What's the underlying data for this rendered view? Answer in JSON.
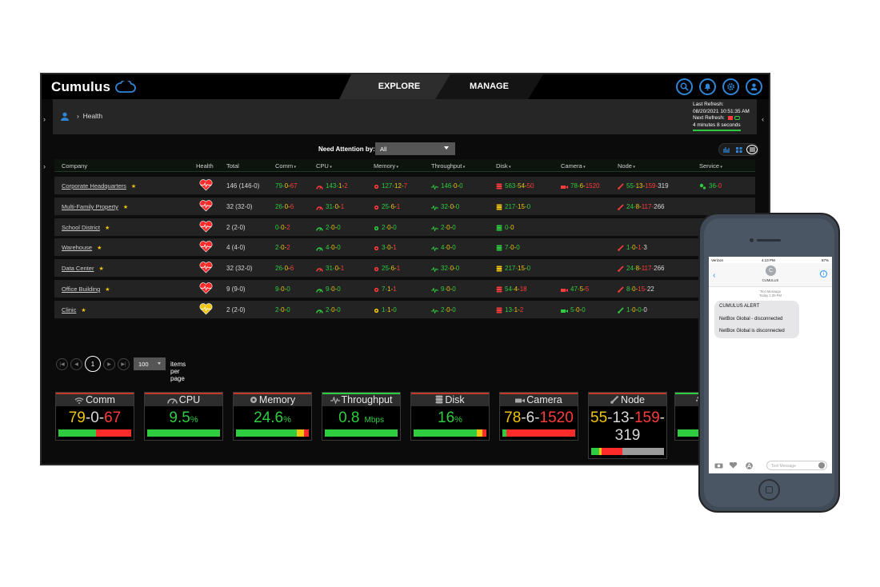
{
  "app": {
    "title": "Cumulus"
  },
  "nav": {
    "tabs": [
      "EXPLORE",
      "MANAGE"
    ]
  },
  "breadcrumb": {
    "current": "Health"
  },
  "refresh": {
    "last_label": "Last Refresh:",
    "last_value": "08/20/2021 10:51:35 AM",
    "next_label": "Next Refresh:",
    "countdown": "4 minutes 8 seconds"
  },
  "filter": {
    "label": "Need Attention by:",
    "value": "All"
  },
  "table": {
    "headers": [
      "Company",
      "Health",
      "Total",
      "Comm",
      "CPU",
      "Memory",
      "Throughput",
      "Disk",
      "Camera",
      "Node",
      "Service"
    ],
    "rows": [
      {
        "company": "Corporate Headquarters",
        "health": "red",
        "total": "146 (146-0)",
        "comm": [
          "79",
          "0",
          "67"
        ],
        "cpu": [
          "143",
          "1",
          "2"
        ],
        "memory": [
          "127",
          "12",
          "7"
        ],
        "throughput": [
          "146",
          "0",
          "0"
        ],
        "disk": [
          "563",
          "54",
          "50"
        ],
        "camera": [
          "78",
          "6",
          "1520"
        ],
        "node": [
          "55",
          "13",
          "159",
          "319"
        ],
        "service": [
          "36",
          "0"
        ]
      },
      {
        "company": "Multi-Family Property",
        "health": "red",
        "total": "32 (32-0)",
        "comm": [
          "26",
          "0",
          "6"
        ],
        "cpu": [
          "31",
          "0",
          "1"
        ],
        "memory": [
          "25",
          "6",
          "1"
        ],
        "throughput": [
          "32",
          "0",
          "0"
        ],
        "disk": [
          "217",
          "15",
          "0"
        ],
        "camera": null,
        "node": [
          "24",
          "8",
          "117",
          "266"
        ],
        "service": null
      },
      {
        "company": "School District",
        "health": "red",
        "total": "2 (2-0)",
        "comm": [
          "0",
          "0",
          "2"
        ],
        "cpu": [
          "2",
          "0",
          "0"
        ],
        "memory": [
          "2",
          "0",
          "0"
        ],
        "throughput": [
          "2",
          "0",
          "0"
        ],
        "disk": [
          "0",
          "0"
        ],
        "camera": null,
        "node": null,
        "service": null
      },
      {
        "company": "Warehouse",
        "health": "red",
        "total": "4 (4-0)",
        "comm": [
          "2",
          "0",
          "2"
        ],
        "cpu": [
          "4",
          "0",
          "0"
        ],
        "memory": [
          "3",
          "0",
          "1"
        ],
        "throughput": [
          "4",
          "0",
          "0"
        ],
        "disk": [
          "7",
          "0",
          "0"
        ],
        "camera": null,
        "node": [
          "1",
          "0",
          "1",
          "3"
        ],
        "service": null
      },
      {
        "company": "Data Center",
        "health": "red",
        "total": "32 (32-0)",
        "comm": [
          "26",
          "0",
          "6"
        ],
        "cpu": [
          "31",
          "0",
          "1"
        ],
        "memory": [
          "25",
          "6",
          "1"
        ],
        "throughput": [
          "32",
          "0",
          "0"
        ],
        "disk": [
          "217",
          "15",
          "0"
        ],
        "camera": null,
        "node": [
          "24",
          "8",
          "117",
          "266"
        ],
        "service": null
      },
      {
        "company": "Office Building",
        "health": "red",
        "total": "9 (9-0)",
        "comm": [
          "9",
          "0",
          "0"
        ],
        "cpu": [
          "9",
          "0",
          "0"
        ],
        "memory": [
          "7",
          "1",
          "1"
        ],
        "throughput": [
          "9",
          "0",
          "0"
        ],
        "disk": [
          "54",
          "4",
          "18"
        ],
        "camera": [
          "47",
          "5",
          "5"
        ],
        "node": [
          "8",
          "0",
          "15",
          "22"
        ],
        "service": null
      },
      {
        "company": "Clinic",
        "health": "yellow",
        "total": "2 (2-0)",
        "comm": [
          "2",
          "0",
          "0"
        ],
        "cpu": [
          "2",
          "0",
          "0"
        ],
        "memory": [
          "1",
          "1",
          "0"
        ],
        "throughput": [
          "2",
          "0",
          "0"
        ],
        "disk": [
          "13",
          "1",
          "2"
        ],
        "camera": [
          "5",
          "0",
          "0"
        ],
        "node": [
          "1",
          "0",
          "0",
          "0"
        ],
        "service": null
      }
    ]
  },
  "pagination": {
    "current_page": "1",
    "per_page": "100",
    "per_page_label": "items per page"
  },
  "summary_cards": [
    {
      "title": "Comm",
      "value": [
        "79",
        "0",
        "67"
      ],
      "bar": [
        0.52,
        0.0,
        0.48
      ]
    },
    {
      "title": "CPU",
      "value": "9.5",
      "unit": "%",
      "bar": [
        1.0,
        0,
        0
      ]
    },
    {
      "title": "Memory",
      "value": "24.6",
      "unit": "%",
      "bar": [
        0.84,
        0.09,
        0.07
      ]
    },
    {
      "title": "Throughput",
      "value": "0.8",
      "unit": "Mbps",
      "bar": [
        1.0,
        0,
        0
      ]
    },
    {
      "title": "Disk",
      "value": "16",
      "unit": "%",
      "bar": [
        0.87,
        0.07,
        0.06
      ]
    },
    {
      "title": "Camera",
      "value": [
        "78",
        "6",
        "1520"
      ],
      "bar": [
        0.05,
        0,
        0.95
      ]
    },
    {
      "title": "Node",
      "value": [
        "55",
        "13",
        "159",
        "319"
      ],
      "bar": [
        0.11,
        0.03,
        0.29,
        0.57
      ]
    }
  ],
  "phone": {
    "carrier": "Verizon",
    "time": "4:13 PM",
    "battery": "87%",
    "contact_initial": "C",
    "contact_name": "CUMULUS",
    "meta_line1": "Text Message",
    "meta_line2": "Today 1:39 PM",
    "message_lines": [
      "CUMULUS ALERT",
      "NetBox Global - disconnected",
      "NetBox Global is disconnected"
    ],
    "composer_placeholder": "Text Message"
  },
  "colors": {
    "good": "#2ecc40",
    "warn": "#f1c40f",
    "bad": "#ff3b3b",
    "accent": "#2f86d6"
  }
}
